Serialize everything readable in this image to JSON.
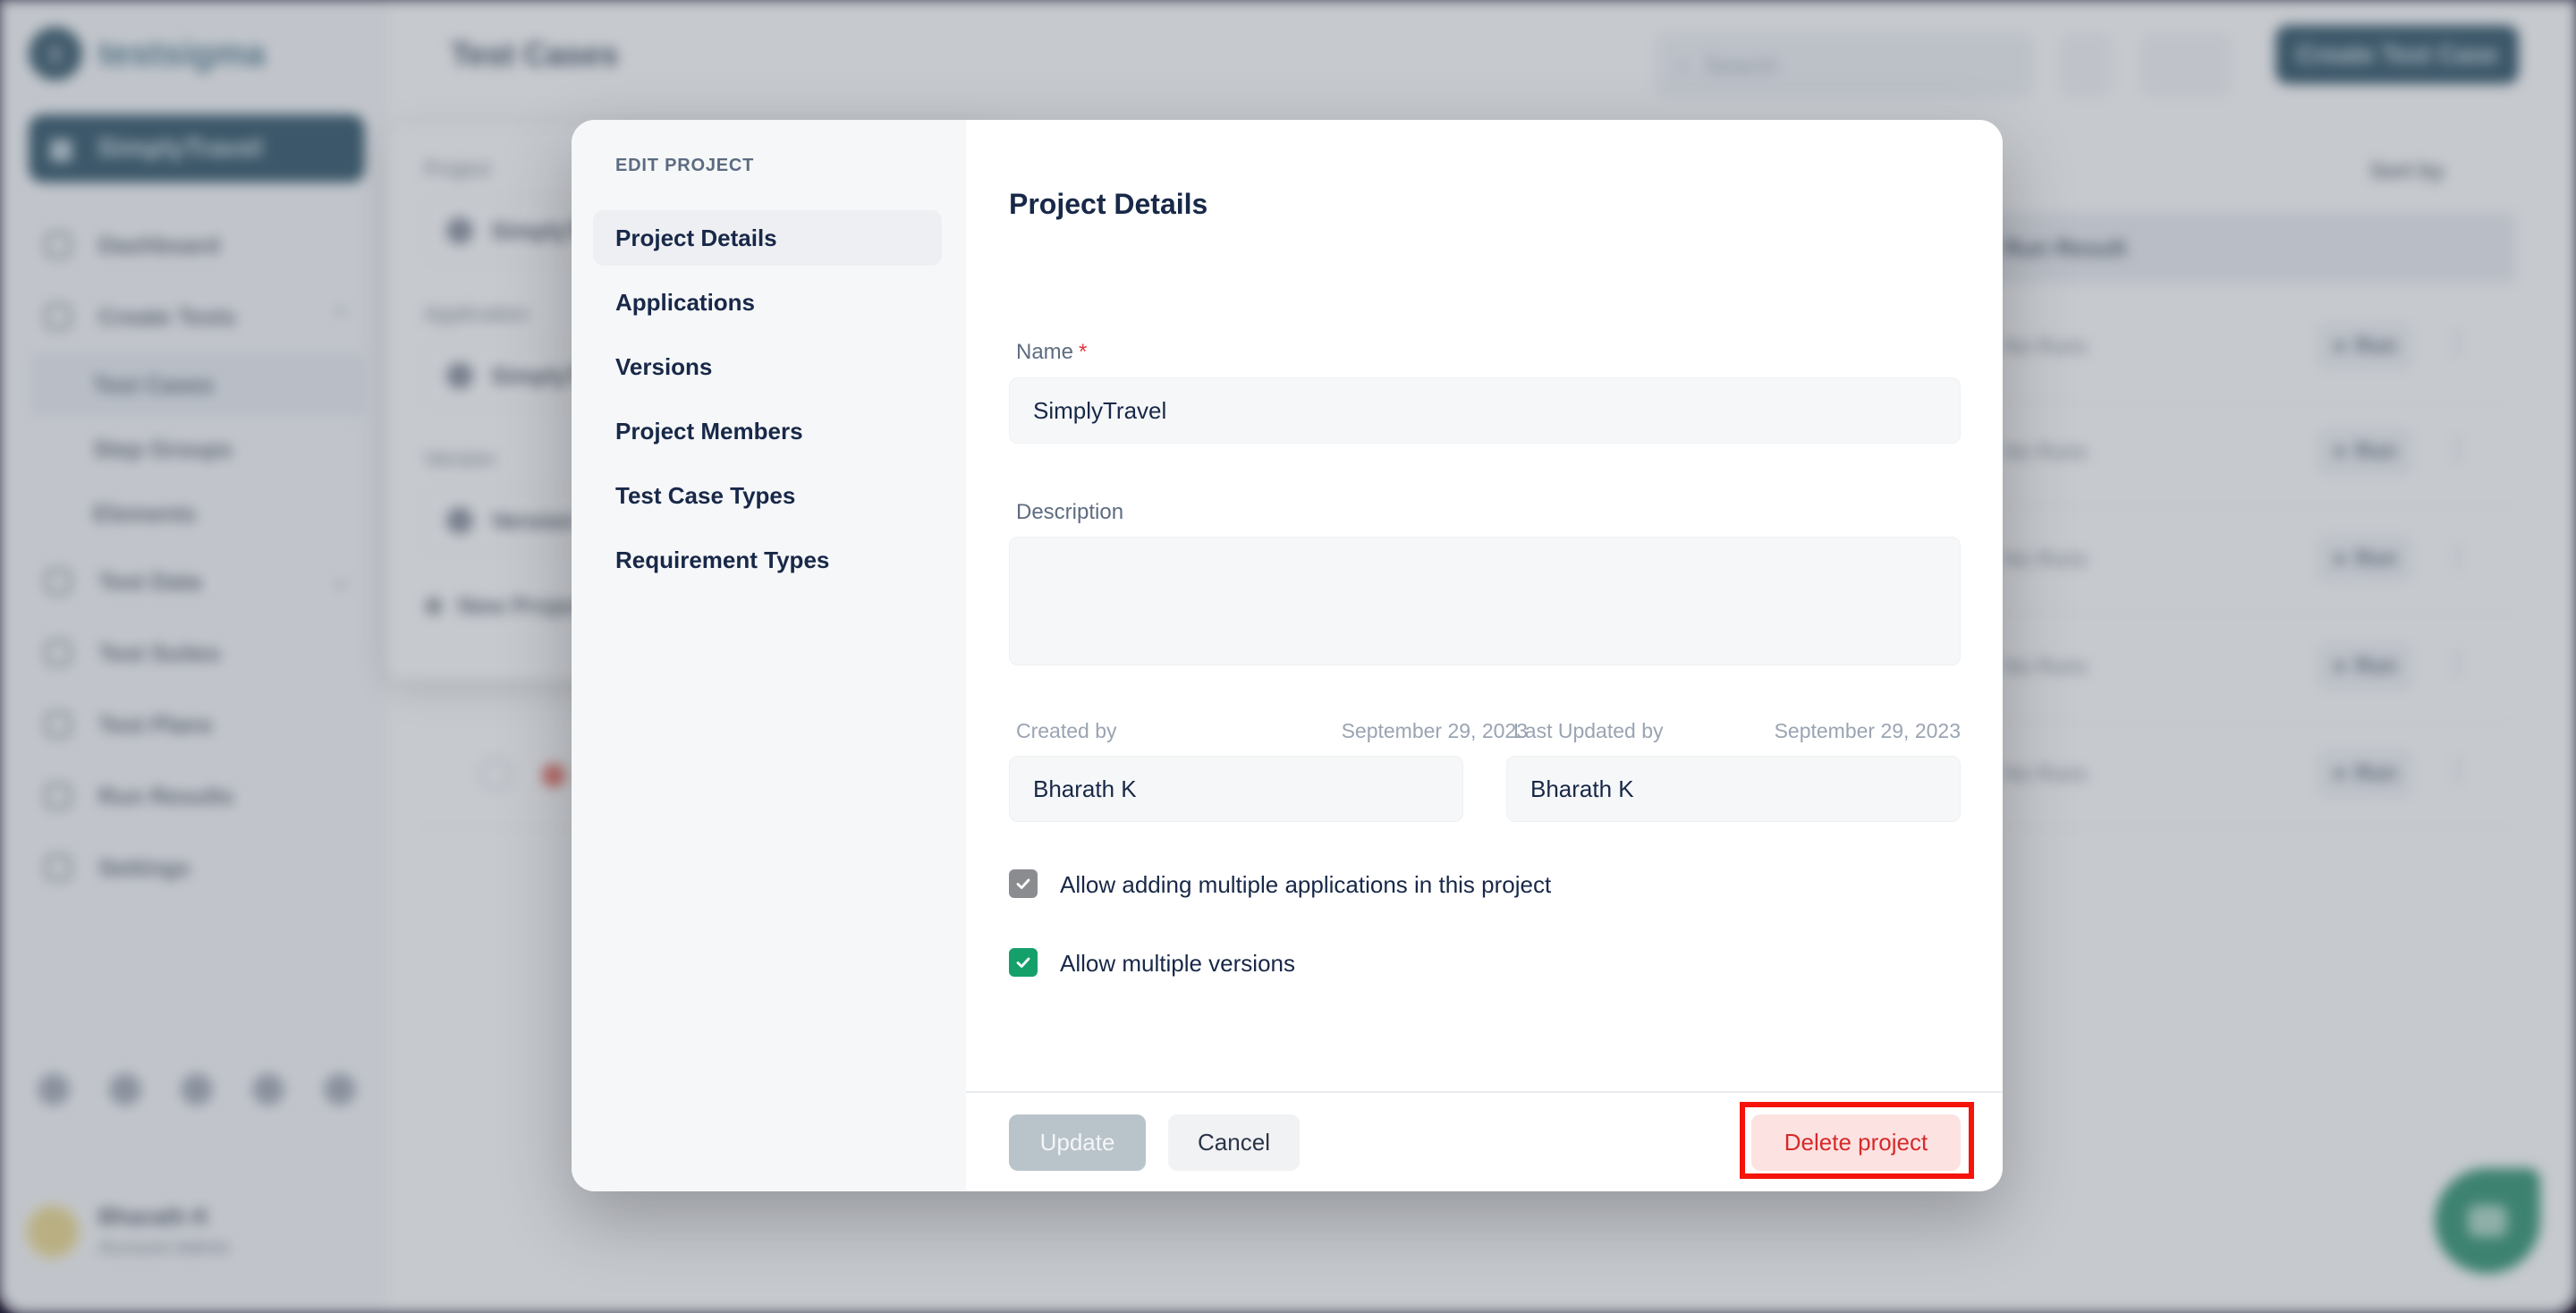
{
  "background": {
    "brand": "testsigma",
    "current_project": "SimplyTravel",
    "sidebar": {
      "items": [
        {
          "label": "Dashboard"
        },
        {
          "label": "Create Tests",
          "expandable": true
        },
        {
          "label": "Test Data",
          "expandable": true
        },
        {
          "label": "Test Suites"
        },
        {
          "label": "Test Plans"
        },
        {
          "label": "Run Results"
        },
        {
          "label": "Settings"
        }
      ],
      "sub_items": [
        "Test Cases",
        "Step Groups",
        "Elements"
      ],
      "active_sub_item": "Test Cases",
      "user": {
        "name": "Bharath K",
        "subtitle": "Account Admin"
      }
    },
    "header": {
      "title": "Test Cases",
      "search_placeholder": "Search",
      "create_button": "Create Test Case"
    },
    "filter_panel": {
      "project_label": "Project",
      "project_value": "SimplyTravel",
      "application_label": "Application",
      "application_value": "SimplyTravel",
      "version_label": "Version",
      "version_value": "Version",
      "new_project": "New Project"
    },
    "table": {
      "sort_label": "Sort by",
      "column_run_result": "Run Result",
      "rows": [
        {
          "run_result": "No Runs",
          "run_button": "Run"
        },
        {
          "run_result": "No Runs",
          "run_button": "Run"
        },
        {
          "run_result": "No Runs",
          "run_button": "Run"
        },
        {
          "run_result": "No Runs",
          "run_button": "Run"
        },
        {
          "run_result": "No Runs",
          "run_button": "Run"
        }
      ]
    }
  },
  "modal": {
    "section_title": "EDIT PROJECT",
    "nav": [
      {
        "label": "Project Details",
        "active": true
      },
      {
        "label": "Applications"
      },
      {
        "label": "Versions"
      },
      {
        "label": "Project Members"
      },
      {
        "label": "Test Case Types"
      },
      {
        "label": "Requirement Types"
      }
    ],
    "title": "Project Details",
    "name_label": "Name",
    "required_marker": "*",
    "name_value": "SimplyTravel",
    "description_label": "Description",
    "description_value": "",
    "created_by_label": "Created by",
    "created_date": "September 29, 2023",
    "created_by_value": "Bharath K",
    "updated_by_label": "Last Updated by",
    "updated_date": "September 29, 2023",
    "updated_by_value": "Bharath K",
    "checkboxes": [
      {
        "label": "Allow adding multiple applications in this project",
        "checked": true,
        "disabled": true
      },
      {
        "label": "Allow multiple versions",
        "checked": true,
        "disabled": false
      }
    ],
    "buttons": {
      "update": "Update",
      "cancel": "Cancel",
      "delete": "Delete project"
    }
  },
  "colors": {
    "brand_dark": "#123c52",
    "delete_text": "#d52a2a",
    "delete_bg": "#fde2e2",
    "checkbox_green": "#14a06a",
    "highlight": "#f5130a"
  }
}
